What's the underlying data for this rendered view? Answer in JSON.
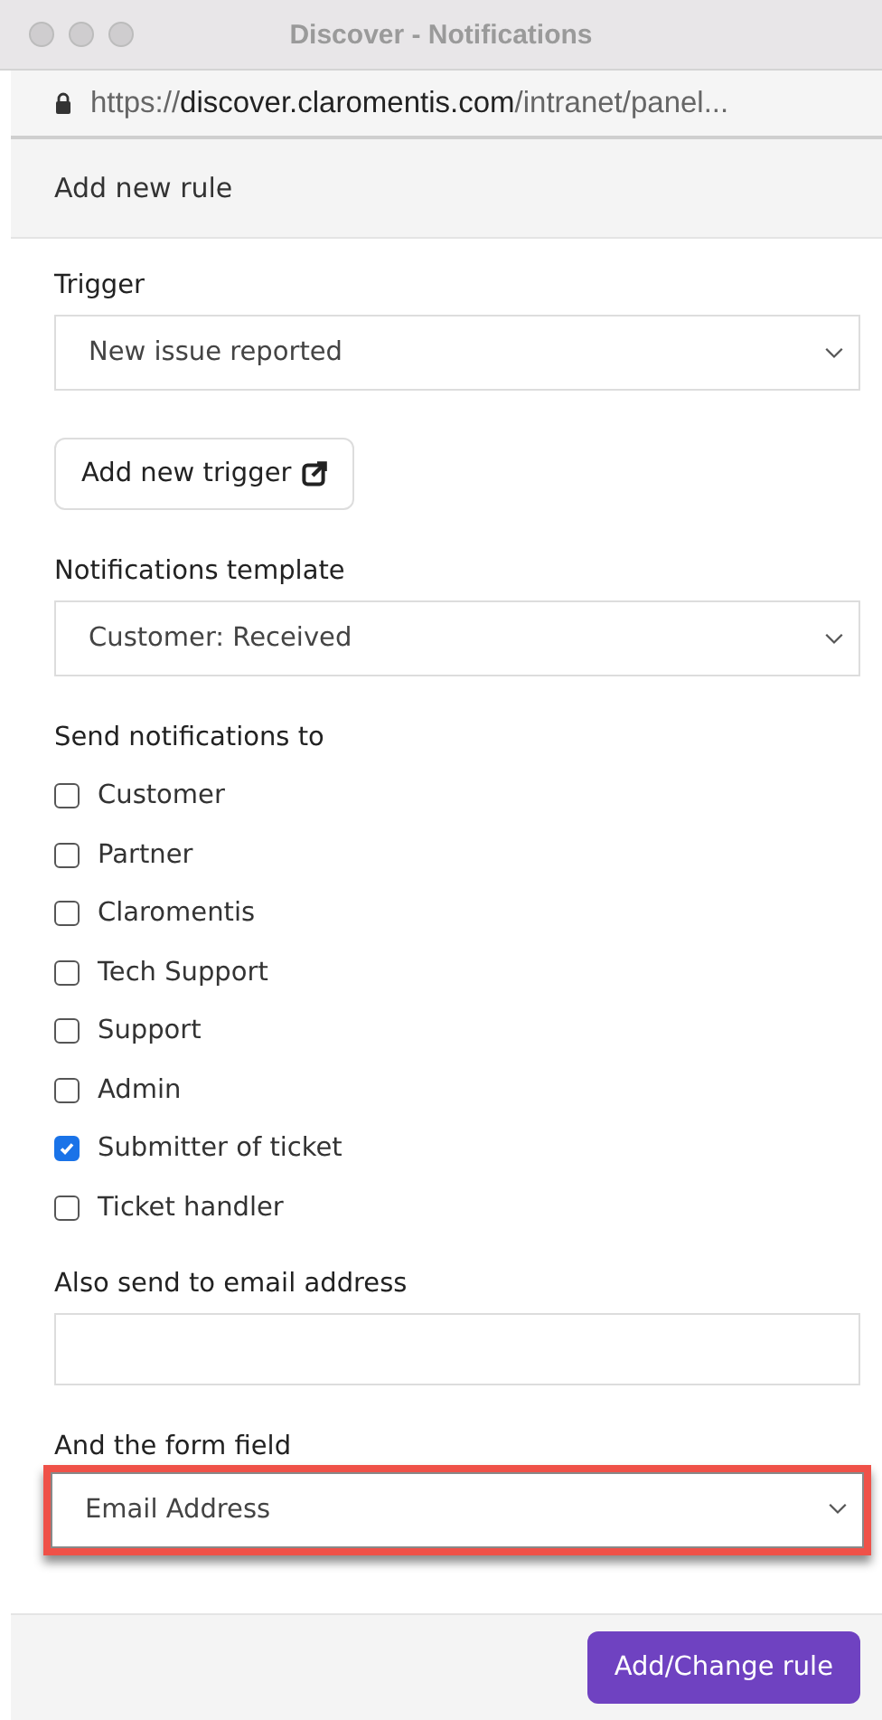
{
  "window": {
    "title": "Discover - Notifications"
  },
  "address_bar": {
    "url": "https://**discover.claromentis.com**/intranet/panel..."
  },
  "panel": {
    "title": "Add new rule"
  },
  "fields": [
    {
      "kind": "select",
      "label": "Trigger",
      "value": "New issue reported",
      "highlighted": false
    },
    {
      "kind": "button",
      "label": "Add new trigger"
    },
    {
      "kind": "select",
      "label": "Notifications template",
      "value": "Customer: Received",
      "highlighted": false
    },
    {
      "kind": "checkboxes",
      "label": "Send notifications to",
      "options": [
        {
          "label": "Customer",
          "checked": false
        },
        {
          "label": "Partner",
          "checked": false
        },
        {
          "label": "Claromentis",
          "checked": false
        },
        {
          "label": "Tech Support",
          "checked": false
        },
        {
          "label": "Support",
          "checked": false
        },
        {
          "label": "Admin",
          "checked": false
        },
        {
          "label": "Submitter of ticket",
          "checked": true
        },
        {
          "label": "Ticket handler",
          "checked": false
        }
      ]
    },
    {
      "kind": "input",
      "label": "Also send to email address"
    },
    {
      "kind": "select",
      "label": "And the form field",
      "value": "Email Address",
      "highlighted": true
    }
  ],
  "footer": {
    "button": "Add/Change rule"
  }
}
